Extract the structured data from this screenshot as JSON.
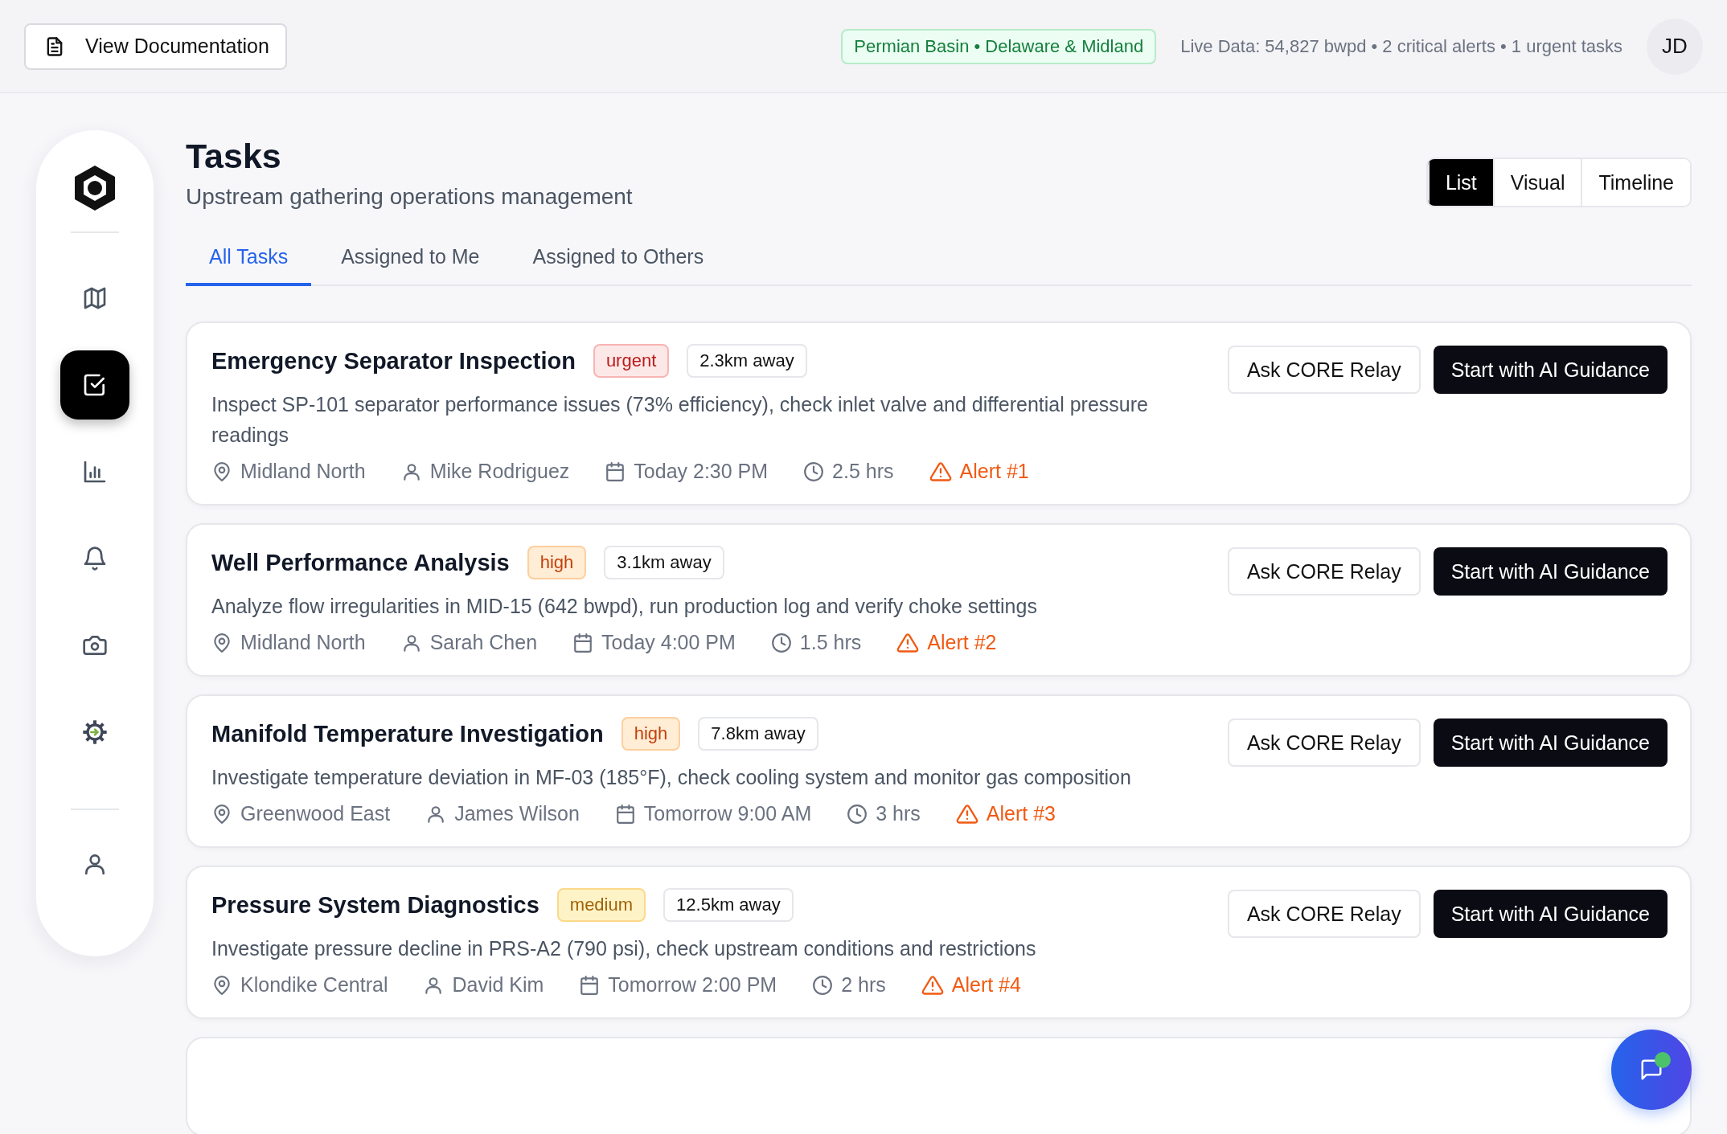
{
  "top_bar": {
    "doc_button": "View Documentation",
    "region_badge": "Permian Basin • Delaware & Midland",
    "live_status": "Live Data: 54,827 bwpd • 2 critical alerts • 1 urgent tasks",
    "avatar": "JD"
  },
  "sidebar": {
    "items": [
      {
        "selected": false
      },
      {
        "selected": true
      },
      {
        "selected": false
      },
      {
        "selected": false
      },
      {
        "selected": false
      },
      {
        "selected": false
      }
    ]
  },
  "header": {
    "title": "Tasks",
    "subtitle": "Upstream gathering operations management"
  },
  "view_toggle": [
    {
      "label": "List",
      "selected": true
    },
    {
      "label": "Visual",
      "selected": false
    },
    {
      "label": "Timeline",
      "selected": false
    }
  ],
  "tabs": [
    {
      "label": "All Tasks",
      "selected": true
    },
    {
      "label": "Assigned to Me",
      "selected": false
    },
    {
      "label": "Assigned to Others",
      "selected": false
    }
  ],
  "tasks": [
    {
      "title": "Emergency Separator Inspection",
      "priority": "urgent",
      "distance": "2.3km away",
      "description": "Inspect SP-101 separator performance issues (73% efficiency), check inlet valve and differential pressure readings",
      "location": "Midland North",
      "assignee": "Mike Rodriguez",
      "due": "Today 2:30 PM",
      "duration": "2.5 hrs",
      "alert": "Alert #1",
      "ask_button": "Ask CORE Relay",
      "start_button": "Start with AI Guidance"
    },
    {
      "title": "Well Performance Analysis",
      "priority": "high",
      "distance": "3.1km away",
      "description": "Analyze flow irregularities in MID-15 (642 bwpd), run production log and verify choke settings",
      "location": "Midland North",
      "assignee": "Sarah Chen",
      "due": "Today 4:00 PM",
      "duration": "1.5 hrs",
      "alert": "Alert #2",
      "ask_button": "Ask CORE Relay",
      "start_button": "Start with AI Guidance"
    },
    {
      "title": "Manifold Temperature Investigation",
      "priority": "high",
      "distance": "7.8km away",
      "description": "Investigate temperature deviation in MF-03 (185°F), check cooling system and monitor gas composition",
      "location": "Greenwood East",
      "assignee": "James Wilson",
      "due": "Tomorrow 9:00 AM",
      "duration": "3 hrs",
      "alert": "Alert #3",
      "ask_button": "Ask CORE Relay",
      "start_button": "Start with AI Guidance"
    },
    {
      "title": "Pressure System Diagnostics",
      "priority": "medium",
      "distance": "12.5km away",
      "description": "Investigate pressure decline in PRS-A2 (790 psi), check upstream conditions and restrictions",
      "location": "Klondike Central",
      "assignee": "David Kim",
      "due": "Tomorrow 2:00 PM",
      "duration": "2 hrs",
      "alert": "Alert #4",
      "ask_button": "Ask CORE Relay",
      "start_button": "Start with AI Guidance"
    }
  ],
  "chat_button": {
    "unread": true
  }
}
